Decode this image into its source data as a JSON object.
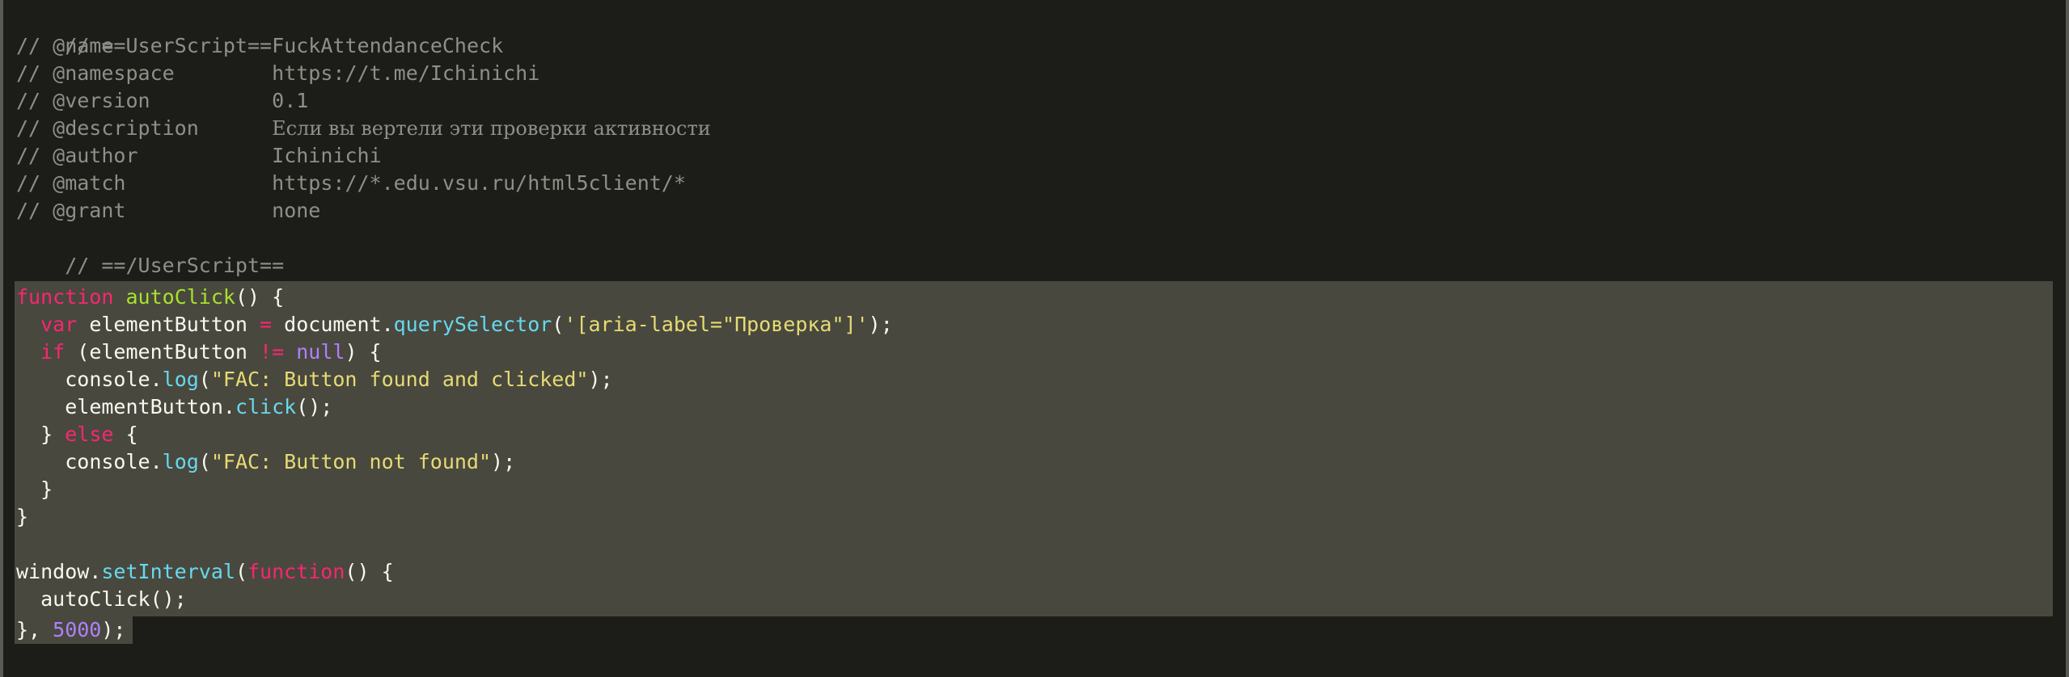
{
  "colors": {
    "background": "#1c1c19",
    "selection": "#49483e",
    "comment": "#8f8f88",
    "keyword": "#f92672",
    "function_name": "#a6e22e",
    "string": "#e6db74",
    "builtin_call": "#66d9ef",
    "number": "#ae81ff",
    "text": "#f8f8f2"
  },
  "header": {
    "open": "// ==UserScript==",
    "meta": [
      {
        "prefix": "// ",
        "key": "@name",
        "value": "FuckAttendanceCheck"
      },
      {
        "prefix": "// ",
        "key": "@namespace",
        "value": "https://t.me/Ichinichi"
      },
      {
        "prefix": "// ",
        "key": "@version",
        "value": "0.1"
      },
      {
        "prefix": "// ",
        "key": "@description",
        "value": "Если вы вертели эти проверки активности"
      },
      {
        "prefix": "// ",
        "key": "@author",
        "value": "Ichinichi"
      },
      {
        "prefix": "// ",
        "key": "@match",
        "value": "https://*.edu.vsu.ru/html5client/*"
      },
      {
        "prefix": "// ",
        "key": "@grant",
        "value": "none"
      }
    ],
    "close": "// ==/UserScript=="
  },
  "code": {
    "l1": {
      "kw": "function",
      "sp": " ",
      "name": "autoClick",
      "rest": "() {"
    },
    "l2": {
      "indent": "  ",
      "kw": "var",
      "a": " elementButton ",
      "op": "=",
      "b": " document.",
      "call": "querySelector",
      "c": "(",
      "str": "'[aria-label=\"Проверка\"]'",
      "d": ");"
    },
    "l3": {
      "indent": "  ",
      "kw": "if",
      "a": " (elementButton ",
      "op": "!=",
      "sp": " ",
      "nul": "null",
      "b": ") {"
    },
    "l4": {
      "indent": "    ",
      "a": "console.",
      "call": "log",
      "b": "(",
      "str": "\"FAC: Button found and clicked\"",
      "c": ");"
    },
    "l5": {
      "indent": "    ",
      "a": "elementButton.",
      "call": "click",
      "b": "();"
    },
    "l6": {
      "indent": "  ",
      "a": "} ",
      "kw": "else",
      "b": " {"
    },
    "l7": {
      "indent": "    ",
      "a": "console.",
      "call": "log",
      "b": "(",
      "str": "\"FAC: Button not found\"",
      "c": ");"
    },
    "l8": {
      "text": "  }"
    },
    "l9": {
      "text": "}"
    },
    "l10": {
      "a": "window.",
      "call": "setInterval",
      "b": "(",
      "kw": "function",
      "c": "() {"
    },
    "l11": {
      "text": "  autoClick();"
    },
    "l12": {
      "a": "}, ",
      "num": "5000",
      "b": ");"
    }
  }
}
